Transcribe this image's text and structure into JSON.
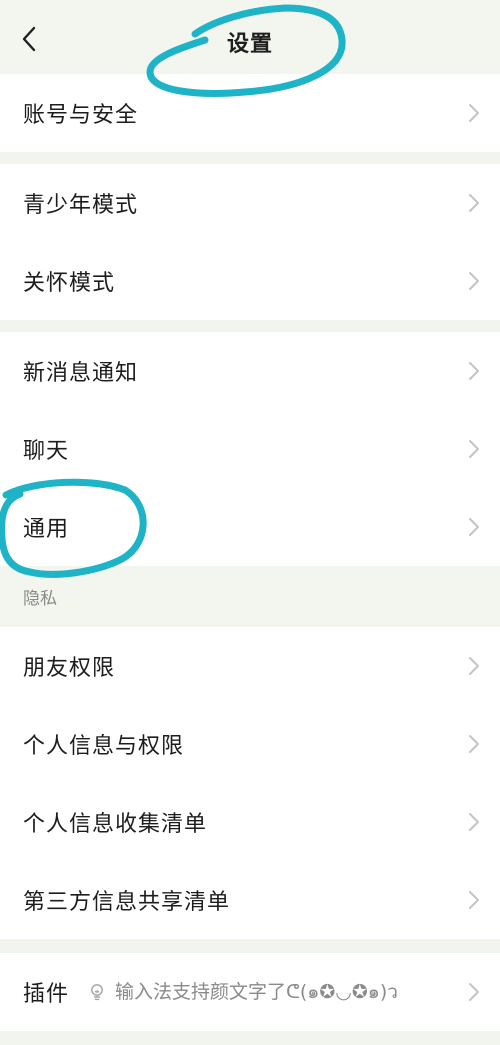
{
  "header": {
    "title": "设置",
    "back_icon": "chevron-left-icon"
  },
  "groups": {
    "g1": {
      "account": "账号与安全"
    },
    "g2": {
      "youth": "青少年模式",
      "care": "关怀模式"
    },
    "g3": {
      "notify": "新消息通知",
      "chat": "聊天",
      "general": "通用"
    },
    "privacy": {
      "section_label": "隐私",
      "friends": "朋友权限",
      "personal": "个人信息与权限",
      "collect": "个人信息收集清单",
      "third": "第三方信息共享清单"
    },
    "g5": {
      "plugin": "插件",
      "plugin_note": "输入法支持颜文字了ᕦ(๑✪◡✪๑)ว",
      "bulb_icon": "lightbulb-icon"
    }
  },
  "colors": {
    "background": "#f2f5ee",
    "row_background": "#ffffff",
    "annotation": "#1fb3c7",
    "chevron": "#c4c4c4"
  }
}
